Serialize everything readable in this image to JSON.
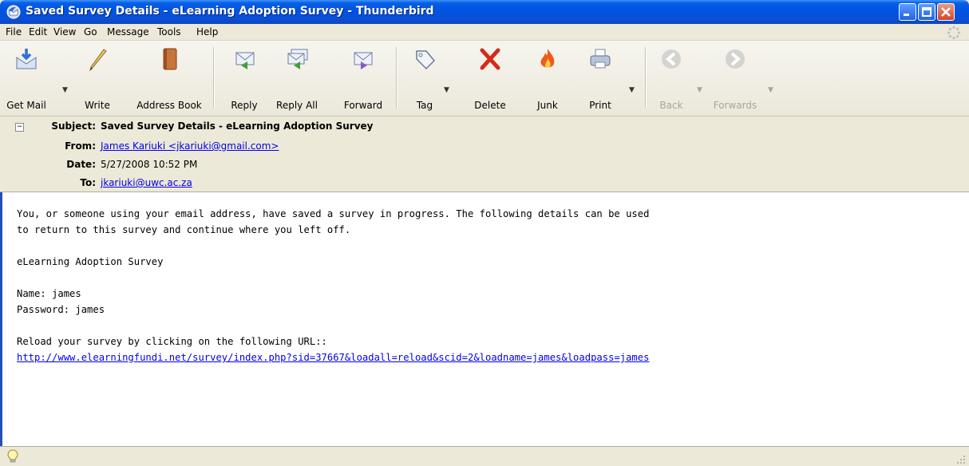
{
  "window": {
    "title": "Saved Survey Details - eLearning Adoption Survey - Thunderbird"
  },
  "menu": [
    "File",
    "Edit",
    "View",
    "Go",
    "Message",
    "Tools",
    "Help"
  ],
  "toolbar": {
    "get_mail": "Get Mail",
    "write": "Write",
    "address_book": "Address Book",
    "reply": "Reply",
    "reply_all": "Reply All",
    "forward": "Forward",
    "tag": "Tag",
    "delete": "Delete",
    "junk": "Junk",
    "print": "Print",
    "back": "Back",
    "forwards": "Forwards"
  },
  "header": {
    "subject_label": "Subject:",
    "subject": "Saved Survey Details - eLearning Adoption Survey",
    "from_label": "From:",
    "from": "James Kariuki <jkariuki@gmail.com>",
    "date_label": "Date:",
    "date": "5/27/2008 10:52 PM",
    "to_label": "To:",
    "to": "jkariuki@uwc.ac.za"
  },
  "body": {
    "line1": "You, or someone using your email address, have saved a survey in progress. The following details can be used",
    "line2": "to return to this survey and continue where you left off.",
    "survey_name": "eLearning Adoption Survey",
    "name_line": "Name: james",
    "password_line": "Password: james",
    "reload_line": "Reload your survey by clicking on the following URL::",
    "url": "http://www.elearningfundi.net/survey/index.php?sid=37667&loadall=reload&scid=2&loadname=james&loadpass=james"
  },
  "colors": {
    "titlebar": "#0054e3",
    "link": "#0000ee",
    "body_border": "#2350b4"
  }
}
